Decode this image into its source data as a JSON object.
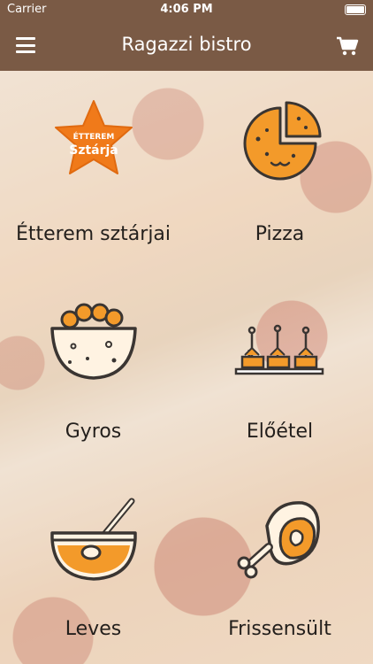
{
  "status": {
    "carrier": "Carrier",
    "time": "4:06 PM"
  },
  "navbar": {
    "title": "Ragazzi bistro"
  },
  "categories": [
    {
      "label": "Étterem sztárjai",
      "badge_line1": "ÉTTEREM",
      "badge_line2": "Sztárja"
    },
    {
      "label": "Pizza"
    },
    {
      "label": "Gyros"
    },
    {
      "label": "Előétel"
    },
    {
      "label": "Leves"
    },
    {
      "label": "Frissensült"
    }
  ],
  "colors": {
    "header": "#7a5a45",
    "accent": "#f39a2a",
    "icon_stroke": "#3a3532"
  }
}
